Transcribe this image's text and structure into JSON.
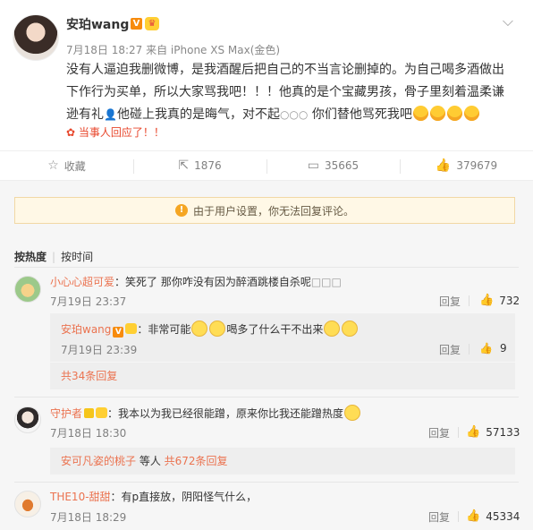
{
  "post": {
    "author": "安珀wang",
    "meta": "7月18日 18:27 来自 iPhone XS Max(金色)",
    "text_a": "没有人逼迫我删微博，是我酒醒后把自己的不当言论删掉的。为自己喝多酒做出下作行为买单，所以大家骂我吧！！！他真的是个宝藏男孩，骨子里刻着温柔谦逊有礼",
    "text_b": "他碰上我真的是晦气，对不起",
    "text_c": "你们替他骂死我吧",
    "reply_note": "当事人回应了！！"
  },
  "actions": {
    "favorite": "收藏",
    "repost": "1876",
    "comment": "35665",
    "like": "379679"
  },
  "notice": "由于用户设置，你无法回复评论。",
  "sort": {
    "hot": "按热度",
    "time": "按时间"
  },
  "comments": [
    {
      "name": "小心心超可爱",
      "text": "：笑死了 那你咋没有因为醉酒跳楼自杀呢",
      "time": "7月19日 23:37",
      "reply": "回复",
      "likes": "732",
      "sub": {
        "name": "安珀wang",
        "text_a": "：非常可能",
        "text_b": "喝多了什么干不出来",
        "time": "7月19日 23:39",
        "reply": "回复",
        "likes": "9"
      },
      "more": "共34条回复"
    },
    {
      "name": "守护者",
      "text": "：我本以为我已经很能蹭，原来你比我还能蹭热度",
      "time": "7月18日 18:30",
      "reply": "回复",
      "likes": "57133",
      "more_user": "安可凡姿的桃子",
      "more_mid": " 等人 ",
      "more_link": "共672条回复"
    },
    {
      "name": "THE10-甜甜",
      "text": "：有p直接放，阴阳怪气什么，",
      "time": "7月18日 18:29",
      "reply": "回复",
      "likes": "45334"
    }
  ]
}
